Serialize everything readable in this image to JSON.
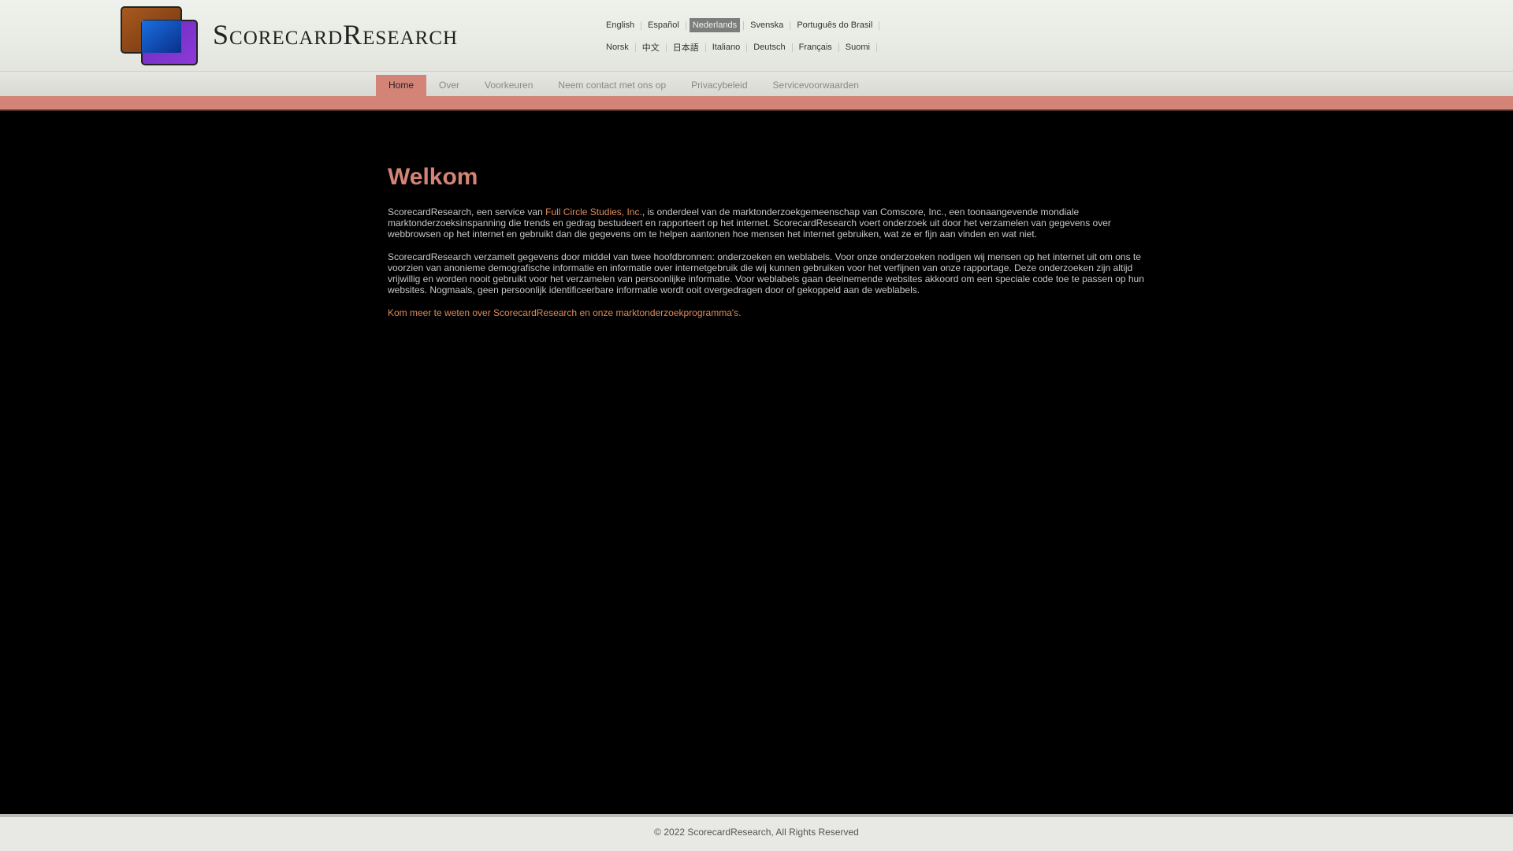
{
  "header": {
    "logo_text": "ScorecardResearch",
    "languages_row1": [
      {
        "label": "English",
        "active": false
      },
      {
        "label": "Español",
        "active": false
      },
      {
        "label": "Nederlands",
        "active": true
      },
      {
        "label": "Svenska",
        "active": false
      },
      {
        "label": "Português do Brasil",
        "active": false
      }
    ],
    "languages_row2": [
      {
        "label": "Norsk",
        "active": false
      },
      {
        "label": "中文",
        "active": false
      },
      {
        "label": "日本語",
        "active": false
      },
      {
        "label": "Italiano",
        "active": false
      },
      {
        "label": "Deutsch",
        "active": false
      },
      {
        "label": "Français",
        "active": false
      },
      {
        "label": "Suomi",
        "active": false
      }
    ]
  },
  "nav": {
    "tabs": [
      {
        "label": "Home",
        "active": true
      },
      {
        "label": "Over",
        "active": false
      },
      {
        "label": "Voorkeuren",
        "active": false
      },
      {
        "label": "Neem contact met ons op",
        "active": false
      },
      {
        "label": "Privacybeleid",
        "active": false
      },
      {
        "label": "Servicevoorwaarden",
        "active": false
      }
    ]
  },
  "main": {
    "title": "Welkom",
    "p1_before": "ScorecardResearch, een service van ",
    "p1_link": "Full Circle Studies, Inc.",
    "p1_after": ", is onderdeel van de marktonderzoekgemeenschap van Comscore, Inc., een toonaangevende mondiale marktonderzoeksinspanning die trends en gedrag bestudeert en rapporteert op het internet. ScorecardResearch voert onderzoek uit door het verzamelen van gegevens over webbrowsen op het internet en gebruikt dan die gegevens om te helpen aantonen hoe mensen het internet gebruiken, wat ze er fijn aan vinden en wat niet.",
    "p2": "ScorecardResearch verzamelt gegevens door middel van twee hoofdbronnen: onderzoeken en weblabels. Voor onze onderzoeken nodigen wij mensen op het internet uit om ons te voorzien van anonieme demografische informatie en informatie over internetgebruik die wij kunnen gebruiken voor het verfijnen van onze rapportage. Deze onderzoeken zijn altijd vrijwillig en worden nooit gebruikt voor het verzamelen van persoonlijke informatie. Voor weblabels gaan deelnemende websites akkoord om een speciale code toe te passen op hun websites. Nogmaals, geen persoonlijk identificeerbare informatie wordt ooit overgedragen door of gekoppeld aan de weblabels.",
    "learn_more_link": "Kom meer te weten over ScorecardResearch en onze marktonderzoekprogramma's."
  },
  "footer": {
    "copyright": "© 2022 ScorecardResearch, All Rights Reserved"
  },
  "colors": {
    "accent": "#d48476",
    "link": "#e08a5a",
    "background": "#000000",
    "header_bg": "#eceee8"
  }
}
